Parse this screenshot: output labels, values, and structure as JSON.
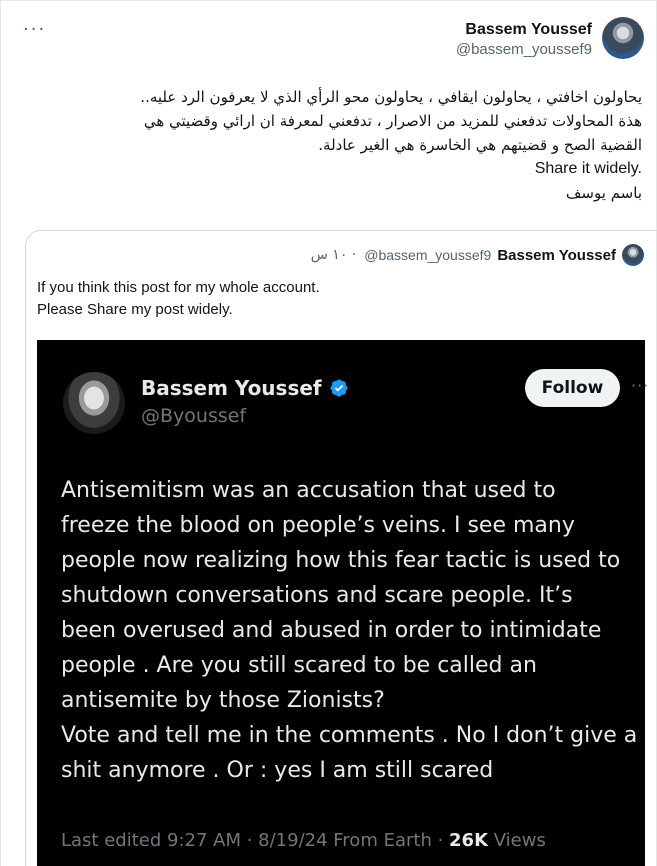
{
  "post": {
    "author_name": "Bassem Youssef",
    "author_handle": "@bassem_youssef9",
    "more_label": "···",
    "text_lines": [
      "يحاولون اخافتي ، يحاولون ايقافي ، يحاولون محو الرأي الذي لا يعرفون الرد عليه..",
      "هذة المحاولات تدفعني للمزيد من الاصرار ، تدفعني لمعرفة ان ارائي وقضيتي هي",
      "القضية الصح و قضيتهم هي الخاسرة هي الغير عادلة.",
      "Share it widely.",
      "باسم يوسف"
    ]
  },
  "quote": {
    "author_name": "Bassem Youssef",
    "author_handle": "@bassem_youssef9",
    "time": "١٠ س ·",
    "text_line1": "If you think this post for my whole account.",
    "text_line2": "Please Share my post widely."
  },
  "screenshot": {
    "name": "Bassem Youssef",
    "handle": "@Byoussef",
    "follow_label": "Follow",
    "more_label": "···",
    "body_lines": [
      "Antisemitism was an accusation that used to",
      "freeze the blood on people’s veins. I see many",
      "people now realizing how this fear tactic is used to",
      "shutdown conversations and scare people. It’s",
      "been overused and abused in order to intimidate",
      "people . Are you still scared to be called an",
      "antisemite by those Zionists?",
      "Vote and tell me in the comments . No I don’t give a",
      "shit anymore . Or : yes I am still scared"
    ],
    "meta_prefix": "Last edited 9:27 AM · 8/19/24  From Earth · ",
    "views_count": "26K",
    "views_label": " Views",
    "verified_color": "#1d9bf0"
  }
}
